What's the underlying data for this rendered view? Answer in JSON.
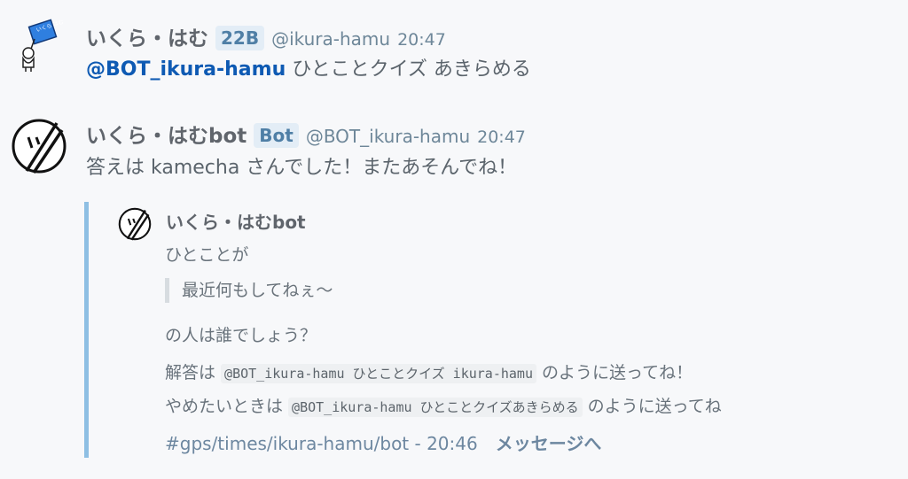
{
  "messages": [
    {
      "username": "いくら・はむ",
      "tag": "22B",
      "handle": "@ikura-hamu",
      "time": "20:47",
      "avatar_icon": "sign-holder-avatar-icon",
      "avatar_sign_text": "いくら はむ",
      "mention": "@BOT_ikura-hamu",
      "text": " ひとことクイズ あきらめる"
    },
    {
      "username": "いくら・はむbot",
      "tag": "Bot",
      "handle": "@BOT_ikura-hamu",
      "time": "20:47",
      "avatar_icon": "bot-face-avatar-icon",
      "text": "答えは kamecha さんでした！またあそんでね！"
    }
  ],
  "embed": {
    "author": "いくら・はむbot",
    "line1": "ひとことが",
    "quote": "最近何もしてねぇ〜",
    "line2": "の人は誰でしょう？",
    "answer_prefix": "解答は ",
    "answer_code": "@BOT_ikura-hamu ひとことクイズ ikura-hamu",
    "answer_suffix": " のように送ってね！",
    "quit_prefix": "やめたいときは ",
    "quit_code": "@BOT_ikura-hamu ひとことクイズあきらめる",
    "quit_suffix": " のように送ってね",
    "channel_link": "#gps/times/ikura-hamu/bot - 20:46",
    "jump_link": "メッセージへ"
  },
  "colors": {
    "background": "#f7f8fa",
    "mention": "#0e5ab3",
    "embed_border": "#8ebfe3",
    "tag_bg": "#e3edf6"
  }
}
